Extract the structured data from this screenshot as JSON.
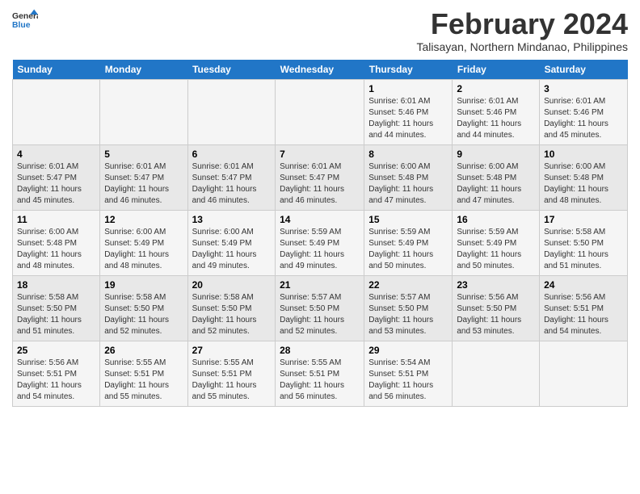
{
  "header": {
    "logo_line1": "General",
    "logo_line2": "Blue",
    "month_year": "February 2024",
    "location": "Talisayan, Northern Mindanao, Philippines"
  },
  "weekdays": [
    "Sunday",
    "Monday",
    "Tuesday",
    "Wednesday",
    "Thursday",
    "Friday",
    "Saturday"
  ],
  "weeks": [
    [
      {
        "day": "",
        "info": ""
      },
      {
        "day": "",
        "info": ""
      },
      {
        "day": "",
        "info": ""
      },
      {
        "day": "",
        "info": ""
      },
      {
        "day": "1",
        "info": "Sunrise: 6:01 AM\nSunset: 5:46 PM\nDaylight: 11 hours\nand 44 minutes."
      },
      {
        "day": "2",
        "info": "Sunrise: 6:01 AM\nSunset: 5:46 PM\nDaylight: 11 hours\nand 44 minutes."
      },
      {
        "day": "3",
        "info": "Sunrise: 6:01 AM\nSunset: 5:46 PM\nDaylight: 11 hours\nand 45 minutes."
      }
    ],
    [
      {
        "day": "4",
        "info": "Sunrise: 6:01 AM\nSunset: 5:47 PM\nDaylight: 11 hours\nand 45 minutes."
      },
      {
        "day": "5",
        "info": "Sunrise: 6:01 AM\nSunset: 5:47 PM\nDaylight: 11 hours\nand 46 minutes."
      },
      {
        "day": "6",
        "info": "Sunrise: 6:01 AM\nSunset: 5:47 PM\nDaylight: 11 hours\nand 46 minutes."
      },
      {
        "day": "7",
        "info": "Sunrise: 6:01 AM\nSunset: 5:47 PM\nDaylight: 11 hours\nand 46 minutes."
      },
      {
        "day": "8",
        "info": "Sunrise: 6:00 AM\nSunset: 5:48 PM\nDaylight: 11 hours\nand 47 minutes."
      },
      {
        "day": "9",
        "info": "Sunrise: 6:00 AM\nSunset: 5:48 PM\nDaylight: 11 hours\nand 47 minutes."
      },
      {
        "day": "10",
        "info": "Sunrise: 6:00 AM\nSunset: 5:48 PM\nDaylight: 11 hours\nand 48 minutes."
      }
    ],
    [
      {
        "day": "11",
        "info": "Sunrise: 6:00 AM\nSunset: 5:48 PM\nDaylight: 11 hours\nand 48 minutes."
      },
      {
        "day": "12",
        "info": "Sunrise: 6:00 AM\nSunset: 5:49 PM\nDaylight: 11 hours\nand 48 minutes."
      },
      {
        "day": "13",
        "info": "Sunrise: 6:00 AM\nSunset: 5:49 PM\nDaylight: 11 hours\nand 49 minutes."
      },
      {
        "day": "14",
        "info": "Sunrise: 5:59 AM\nSunset: 5:49 PM\nDaylight: 11 hours\nand 49 minutes."
      },
      {
        "day": "15",
        "info": "Sunrise: 5:59 AM\nSunset: 5:49 PM\nDaylight: 11 hours\nand 50 minutes."
      },
      {
        "day": "16",
        "info": "Sunrise: 5:59 AM\nSunset: 5:49 PM\nDaylight: 11 hours\nand 50 minutes."
      },
      {
        "day": "17",
        "info": "Sunrise: 5:58 AM\nSunset: 5:50 PM\nDaylight: 11 hours\nand 51 minutes."
      }
    ],
    [
      {
        "day": "18",
        "info": "Sunrise: 5:58 AM\nSunset: 5:50 PM\nDaylight: 11 hours\nand 51 minutes."
      },
      {
        "day": "19",
        "info": "Sunrise: 5:58 AM\nSunset: 5:50 PM\nDaylight: 11 hours\nand 52 minutes."
      },
      {
        "day": "20",
        "info": "Sunrise: 5:58 AM\nSunset: 5:50 PM\nDaylight: 11 hours\nand 52 minutes."
      },
      {
        "day": "21",
        "info": "Sunrise: 5:57 AM\nSunset: 5:50 PM\nDaylight: 11 hours\nand 52 minutes."
      },
      {
        "day": "22",
        "info": "Sunrise: 5:57 AM\nSunset: 5:50 PM\nDaylight: 11 hours\nand 53 minutes."
      },
      {
        "day": "23",
        "info": "Sunrise: 5:56 AM\nSunset: 5:50 PM\nDaylight: 11 hours\nand 53 minutes."
      },
      {
        "day": "24",
        "info": "Sunrise: 5:56 AM\nSunset: 5:51 PM\nDaylight: 11 hours\nand 54 minutes."
      }
    ],
    [
      {
        "day": "25",
        "info": "Sunrise: 5:56 AM\nSunset: 5:51 PM\nDaylight: 11 hours\nand 54 minutes."
      },
      {
        "day": "26",
        "info": "Sunrise: 5:55 AM\nSunset: 5:51 PM\nDaylight: 11 hours\nand 55 minutes."
      },
      {
        "day": "27",
        "info": "Sunrise: 5:55 AM\nSunset: 5:51 PM\nDaylight: 11 hours\nand 55 minutes."
      },
      {
        "day": "28",
        "info": "Sunrise: 5:55 AM\nSunset: 5:51 PM\nDaylight: 11 hours\nand 56 minutes."
      },
      {
        "day": "29",
        "info": "Sunrise: 5:54 AM\nSunset: 5:51 PM\nDaylight: 11 hours\nand 56 minutes."
      },
      {
        "day": "",
        "info": ""
      },
      {
        "day": "",
        "info": ""
      }
    ]
  ]
}
